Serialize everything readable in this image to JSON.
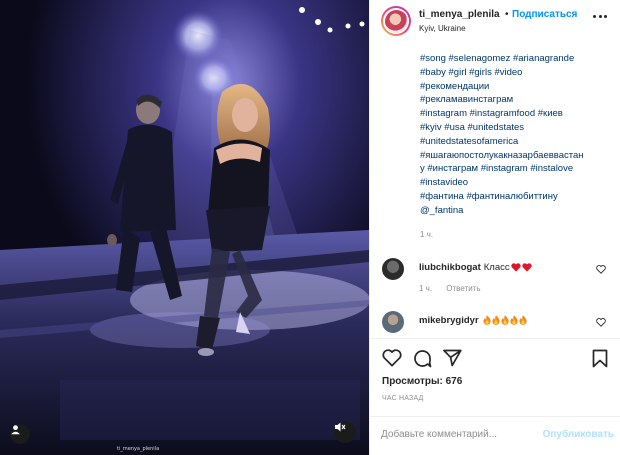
{
  "post": {
    "username": "ti_menya_plenila",
    "follow_label": "Подписаться",
    "separator": "•",
    "location": "Kyiv, Ukraine",
    "hashtag_lines": [
      "#song #selenagomez #arianagrande",
      "#baby #girl #girls #video",
      "#рекомендации",
      "#рекламавинстаграм",
      "#instagram #instagramfood #киев",
      "#kyiv #usa #unitedstates",
      "#unitedstatesofamerica",
      "#яшагаюпостолукакназарбаеввастан",
      "у #инстаграм #instagram #instalove",
      "#instavideo",
      "#фантина #фантиналюбиттину",
      "@_fantina"
    ],
    "time": "1 ч."
  },
  "comments": [
    {
      "username": "liubchikbogat",
      "text": "Класс",
      "emoji": [
        "red-heart",
        "red-heart"
      ],
      "time": "1 ч.",
      "reply_label": "Ответить"
    },
    {
      "username": "mikebrygidyr",
      "text": "",
      "emoji": [
        "fire",
        "fire",
        "fire",
        "fire",
        "fire"
      ]
    }
  ],
  "stats": {
    "views_label": "Просмотры: 676",
    "posted_ago": "ЧАС НАЗАД"
  },
  "composer": {
    "placeholder": "Добавьте комментарий...",
    "publish_label": "Опубликовать"
  },
  "video": {
    "watermark": "ti_menya_plenila"
  },
  "icons": [
    "more-options-icon",
    "like-icon",
    "comment-icon",
    "share-icon",
    "save-icon",
    "user-tag-icon",
    "mute-icon",
    "heart-small-icon"
  ],
  "colors": {
    "accent": "#0095f6",
    "publish_disabled": "#b2dffc",
    "link": "#00376b",
    "muted": "#8e8e8e"
  }
}
